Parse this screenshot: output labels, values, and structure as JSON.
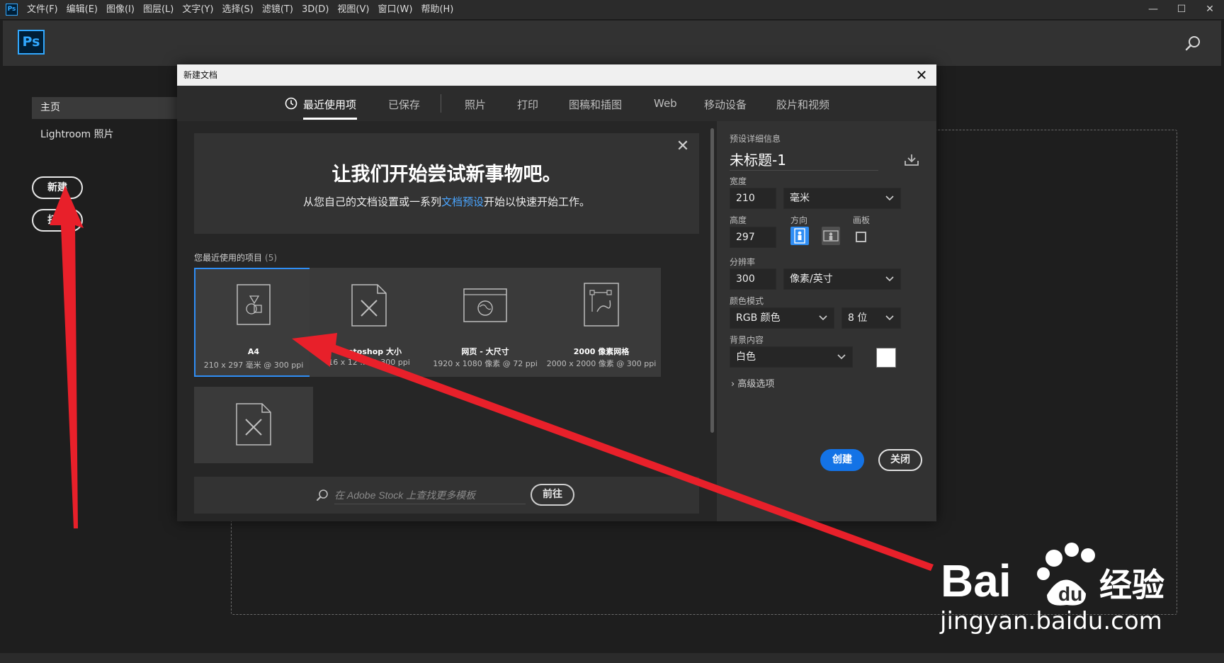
{
  "menubar": {
    "app_icon": "Ps",
    "items": [
      "文件(F)",
      "编辑(E)",
      "图像(I)",
      "图层(L)",
      "文字(Y)",
      "选择(S)",
      "滤镜(T)",
      "3D(D)",
      "视图(V)",
      "窗口(W)",
      "帮助(H)"
    ],
    "window_controls": [
      "—",
      "☐",
      "✕"
    ]
  },
  "header": {
    "logo": "Ps"
  },
  "left_panel": {
    "home": "主页",
    "lightroom": "Lightroom 照片",
    "new_button": "新建",
    "open_button": "打开"
  },
  "dialog": {
    "title": "新建文档",
    "tabs": [
      "最近使用项",
      "已保存",
      "照片",
      "打印",
      "图稿和插图",
      "Web",
      "移动设备",
      "胶片和视频"
    ],
    "active_tab": "最近使用项",
    "hero": {
      "title": "让我们开始尝试新事物吧。",
      "subtitle_before": "从您自己的文档设置或一系列",
      "subtitle_link": "文档预设",
      "subtitle_after": "开始以快速开始工作。"
    },
    "recent_label": "您最近使用的项目",
    "recent_count": "(5)",
    "cards": [
      {
        "name": "A4",
        "meta": "210 x 297 毫米 @ 300 ppi",
        "icon": "a4-doc-icon"
      },
      {
        "name": "Photoshop 大小",
        "meta": "16 x 12 … @ 300 ppi",
        "icon": "custom-doc-icon"
      },
      {
        "name": "网页 - 大尺寸",
        "meta": "1920 x 1080 像素 @ 72 ppi",
        "icon": "web-doc-icon"
      },
      {
        "name": "2000 像素网格",
        "meta": "2000 x 2000 像素 @ 300 ppi",
        "icon": "grid-doc-icon"
      },
      {
        "name": "",
        "meta": "",
        "icon": "custom-doc-icon"
      }
    ],
    "stock": {
      "placeholder": "在 Adobe Stock 上查找更多模板",
      "goto": "前往"
    },
    "details": {
      "heading": "预设详细信息",
      "name": "未标题-1",
      "width_label": "宽度",
      "width_value": "210",
      "width_unit": "毫米",
      "height_label": "高度",
      "height_value": "297",
      "orientation_label": "方向",
      "artboard_label": "画板",
      "resolution_label": "分辨率",
      "resolution_value": "300",
      "resolution_unit": "像素/英寸",
      "color_mode_label": "颜色模式",
      "color_mode_value": "RGB 颜色",
      "bit_depth": "8 位",
      "background_label": "背景内容",
      "background_value": "白色",
      "advanced": "高级选项",
      "create": "创建",
      "close": "关闭"
    }
  },
  "watermark": {
    "text": "jingyan.baidu.com",
    "brand": "Bai du 经验"
  },
  "colors": {
    "accent": "#1473e6",
    "link": "#4aa5ff",
    "arrow": "#e8202a",
    "selected_border": "#2f8ef5"
  }
}
